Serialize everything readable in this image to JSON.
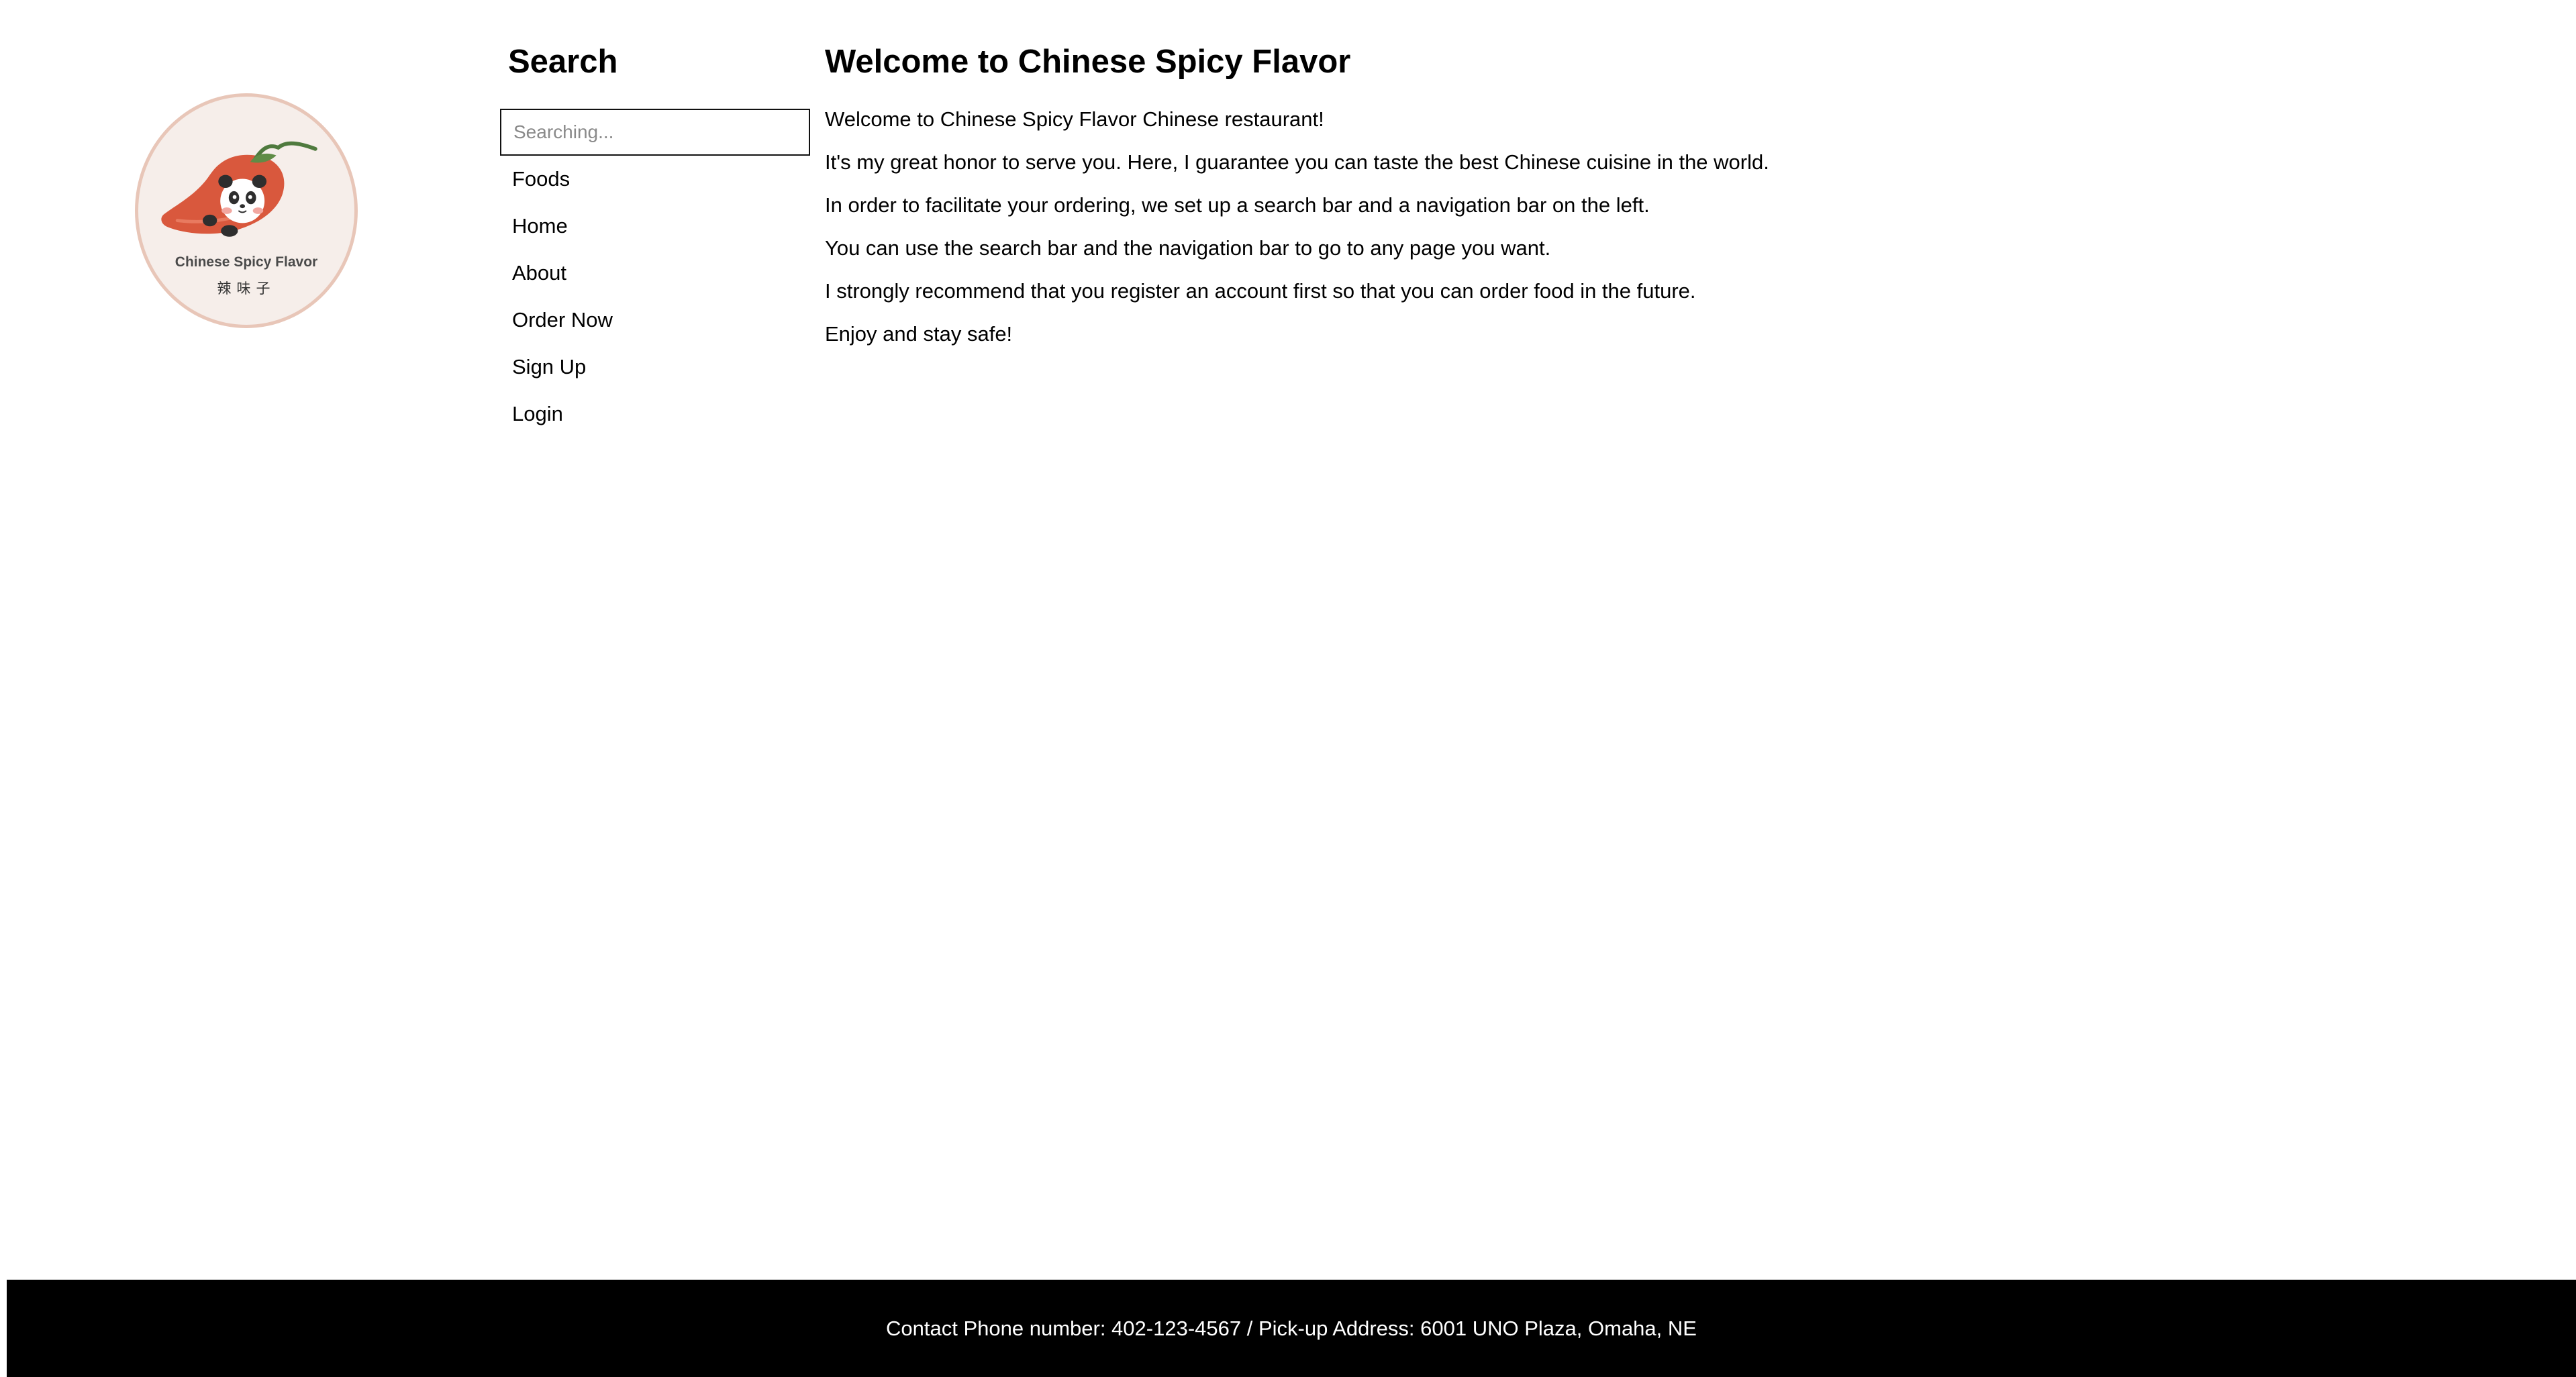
{
  "logo": {
    "name": "Chinese Spicy Flavor",
    "chinese_name": "辣味子",
    "icon": "chili-panda-logo"
  },
  "sidebar": {
    "heading": "Search",
    "search_placeholder": "Searching...",
    "search_value": "",
    "nav_items": [
      {
        "label": "Foods"
      },
      {
        "label": "Home"
      },
      {
        "label": "About"
      },
      {
        "label": "Order Now"
      },
      {
        "label": "Sign Up"
      },
      {
        "label": "Login"
      }
    ]
  },
  "main": {
    "title": "Welcome to Chinese Spicy Flavor",
    "paragraphs": [
      "Welcome to Chinese Spicy Flavor Chinese restaurant!",
      "It's my great honor to serve you. Here, I guarantee you can taste the best Chinese cuisine in the world.",
      "In order to facilitate your ordering, we set up a search bar and a navigation bar on the left.",
      "You can use the search bar and the navigation bar to go to any page you want.",
      "I strongly recommend that you register an account first so that you can order food in the future.",
      "Enjoy and stay safe!"
    ]
  },
  "footer": {
    "text": "Contact Phone number: 402-123-4567 / Pick-up Address: 6001 UNO Plaza, Omaha, NE"
  },
  "colors": {
    "logo_background": "#f6eeea",
    "logo_border": "#e8c6b8",
    "chili_red": "#d9583d",
    "stem_green": "#4f7a3e",
    "footer_background": "#000000",
    "footer_text": "#ffffff"
  }
}
